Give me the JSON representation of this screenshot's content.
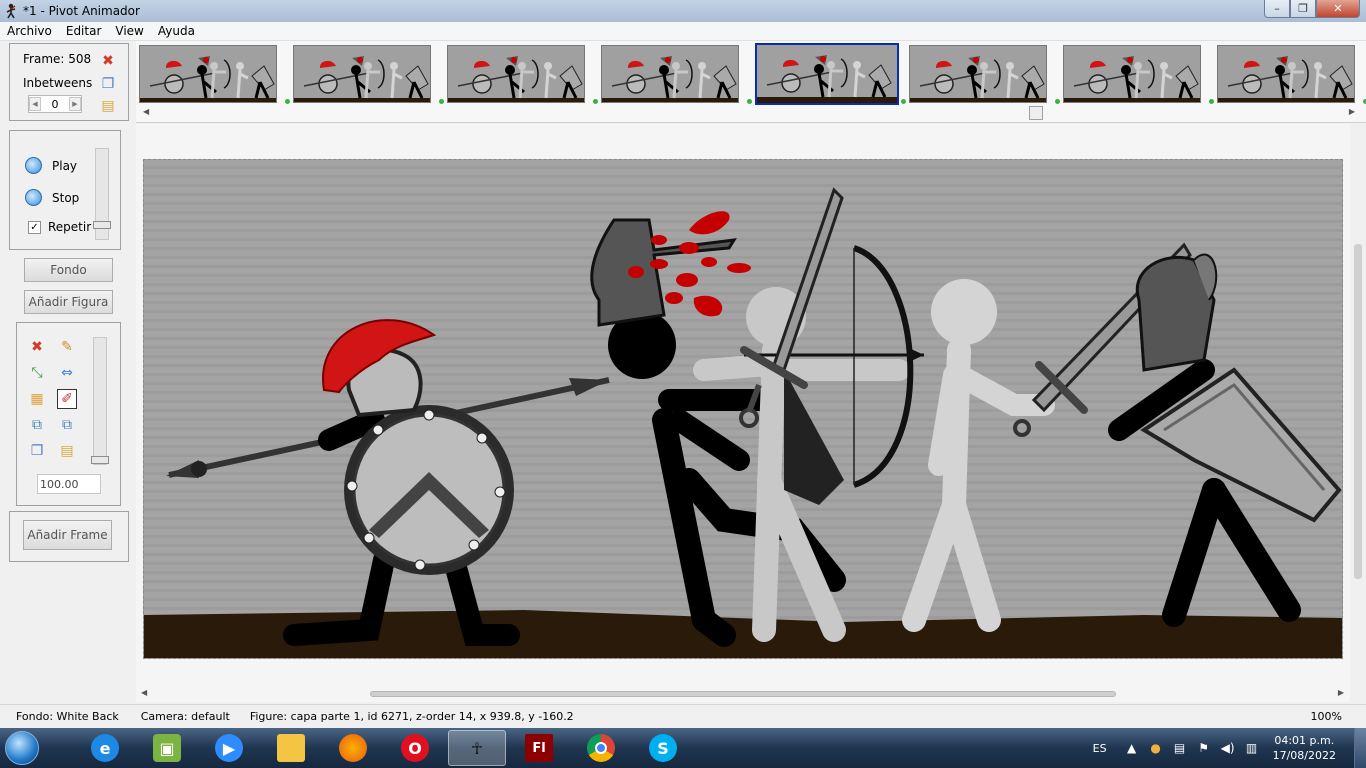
{
  "window": {
    "title": "*1 - Pivot Animador",
    "minimize": "–",
    "maximize": "❐",
    "close": "✕"
  },
  "menu": [
    "Archivo",
    "Editar",
    "View",
    "Ayuda"
  ],
  "frame_panel": {
    "frame_label": "Frame: 508",
    "inbetweens_label": "Inbetweens",
    "inbetweens_value": "0"
  },
  "playback": {
    "play_label": "Play",
    "stop_label": "Stop",
    "repeat_label": "Repetir",
    "repeat_checked": true
  },
  "buttons": {
    "background": "Fondo",
    "add_figure": "Añadir Figura",
    "add_frame": "Añadir Frame"
  },
  "tools": {
    "icons": [
      "delete-icon",
      "pencil-icon",
      "shrink-icon",
      "flip-icon",
      "color-grid-icon",
      "brush-icon",
      "stack-back-icon",
      "stack-front-icon",
      "copy-icon",
      "paste-icon"
    ],
    "zoom_value": "100.00"
  },
  "timeline": {
    "thumbnail_count": 8,
    "selected_index": 4
  },
  "status": {
    "background": "Fondo: White Back",
    "camera": "Camera: default",
    "figure": "Figure: capa parte 1,  id 6271,  z-order 14,  x 939.8, y -160.2",
    "zoom": "100%"
  },
  "taskbar": {
    "apps": [
      "internet-explorer",
      "notepad-plus",
      "zoom",
      "file-explorer",
      "firefox",
      "opera",
      "pivot-animator",
      "flash",
      "chrome",
      "skype"
    ],
    "active_app": "pivot-animator",
    "language": "ES",
    "time": "04:01 p.m.",
    "date": "17/08/2022"
  },
  "colors": {
    "accent_selected": "#0a2ea8",
    "ground": "#2a1a0a",
    "blood": "#c40000"
  }
}
